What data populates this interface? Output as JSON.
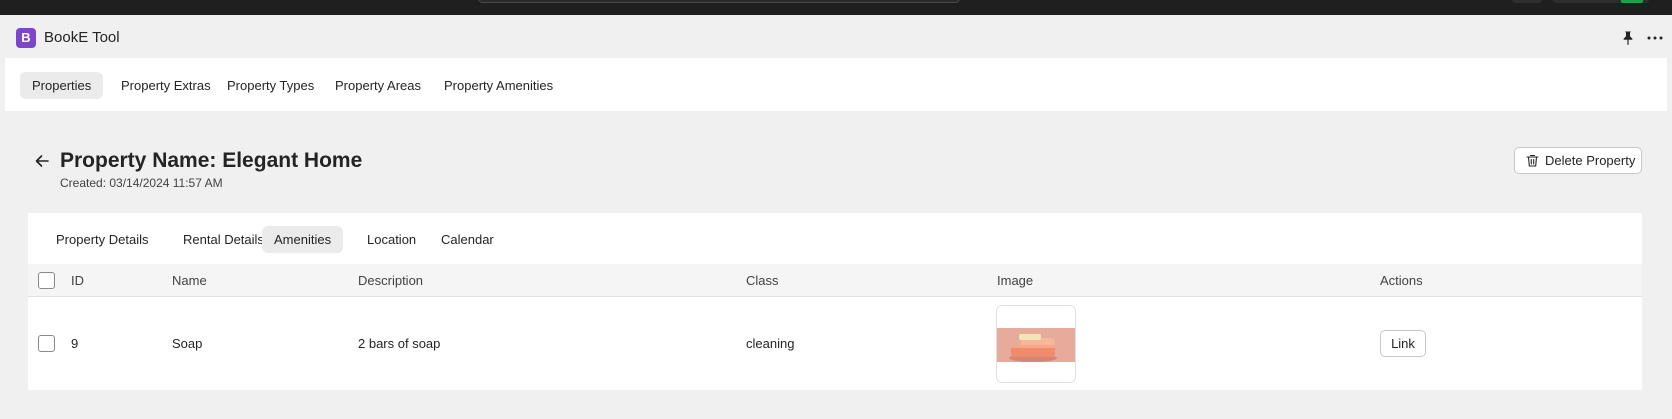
{
  "app": {
    "logo_letter": "B",
    "title": "BookE Tool"
  },
  "topbar": {
    "pin_icon": "pin-icon",
    "more_icon": "more-horizontal-icon"
  },
  "nav": {
    "tabs": [
      {
        "label": "Properties",
        "active": true
      },
      {
        "label": "Property Extras",
        "active": false
      },
      {
        "label": "Property Types",
        "active": false
      },
      {
        "label": "Property Areas",
        "active": false
      },
      {
        "label": "Property Amenities",
        "active": false
      }
    ]
  },
  "page": {
    "back_icon": "arrow-left-icon",
    "title": "Property Name: Elegant Home",
    "created": "Created: 03/14/2024 11:57 AM",
    "delete_label": "Delete Property",
    "delete_icon": "trash-icon"
  },
  "subtabs": [
    {
      "label": "Property Details",
      "active": false
    },
    {
      "label": "Rental Details",
      "active": false
    },
    {
      "label": "Amenities",
      "active": true
    },
    {
      "label": "Location",
      "active": false
    },
    {
      "label": "Calendar",
      "active": false
    }
  ],
  "table": {
    "columns": [
      "ID",
      "Name",
      "Description",
      "Class",
      "Image",
      "Actions"
    ],
    "rows": [
      {
        "id": "9",
        "name": "Soap",
        "description": "2 bars of soap",
        "class": "cleaning",
        "image": "soap-bars-image",
        "action_label": "Link"
      }
    ]
  },
  "colors": {
    "brand": "#7d45c9",
    "background": "#f0f0f0",
    "surface": "#ffffff",
    "active_tab": "#ebebeb"
  }
}
